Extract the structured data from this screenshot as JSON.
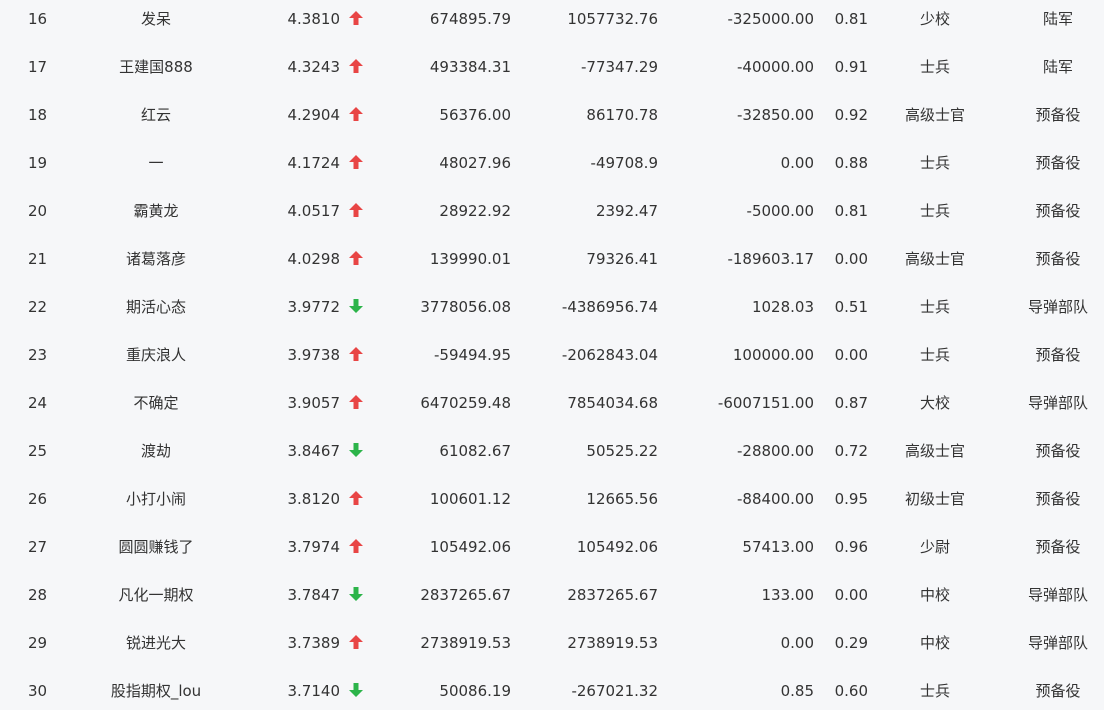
{
  "colors": {
    "up": "#e84545",
    "down": "#2cb44a",
    "text": "#333333",
    "background": "#f6f7f9"
  },
  "rows": [
    {
      "rank": "16",
      "name": "发呆",
      "score": "4.3810",
      "trend": "up",
      "value_a": "674895.79",
      "value_b": "1057732.76",
      "value_c": "-325000.00",
      "ratio": "0.81",
      "military_rank": "少校",
      "unit": "陆军"
    },
    {
      "rank": "17",
      "name": "王建国888",
      "score": "4.3243",
      "trend": "up",
      "value_a": "493384.31",
      "value_b": "-77347.29",
      "value_c": "-40000.00",
      "ratio": "0.91",
      "military_rank": "士兵",
      "unit": "陆军"
    },
    {
      "rank": "18",
      "name": "红云",
      "score": "4.2904",
      "trend": "up",
      "value_a": "56376.00",
      "value_b": "86170.78",
      "value_c": "-32850.00",
      "ratio": "0.92",
      "military_rank": "高级士官",
      "unit": "预备役"
    },
    {
      "rank": "19",
      "name": "一",
      "score": "4.1724",
      "trend": "up",
      "value_a": "48027.96",
      "value_b": "-49708.9",
      "value_c": "0.00",
      "ratio": "0.88",
      "military_rank": "士兵",
      "unit": "预备役"
    },
    {
      "rank": "20",
      "name": "霸黄龙",
      "score": "4.0517",
      "trend": "up",
      "value_a": "28922.92",
      "value_b": "2392.47",
      "value_c": "-5000.00",
      "ratio": "0.81",
      "military_rank": "士兵",
      "unit": "预备役"
    },
    {
      "rank": "21",
      "name": "诸葛落彦",
      "score": "4.0298",
      "trend": "up",
      "value_a": "139990.01",
      "value_b": "79326.41",
      "value_c": "-189603.17",
      "ratio": "0.00",
      "military_rank": "高级士官",
      "unit": "预备役"
    },
    {
      "rank": "22",
      "name": "期活心态",
      "score": "3.9772",
      "trend": "down",
      "value_a": "3778056.08",
      "value_b": "-4386956.74",
      "value_c": "1028.03",
      "ratio": "0.51",
      "military_rank": "士兵",
      "unit": "导弹部队"
    },
    {
      "rank": "23",
      "name": "重庆浪人",
      "score": "3.9738",
      "trend": "up",
      "value_a": "-59494.95",
      "value_b": "-2062843.04",
      "value_c": "100000.00",
      "ratio": "0.00",
      "military_rank": "士兵",
      "unit": "预备役"
    },
    {
      "rank": "24",
      "name": "不确定",
      "score": "3.9057",
      "trend": "up",
      "value_a": "6470259.48",
      "value_b": "7854034.68",
      "value_c": "-6007151.00",
      "ratio": "0.87",
      "military_rank": "大校",
      "unit": "导弹部队"
    },
    {
      "rank": "25",
      "name": "渡劫",
      "score": "3.8467",
      "trend": "down",
      "value_a": "61082.67",
      "value_b": "50525.22",
      "value_c": "-28800.00",
      "ratio": "0.72",
      "military_rank": "高级士官",
      "unit": "预备役"
    },
    {
      "rank": "26",
      "name": "小打小闹",
      "score": "3.8120",
      "trend": "up",
      "value_a": "100601.12",
      "value_b": "12665.56",
      "value_c": "-88400.00",
      "ratio": "0.95",
      "military_rank": "初级士官",
      "unit": "预备役"
    },
    {
      "rank": "27",
      "name": "圆圆赚钱了",
      "score": "3.7974",
      "trend": "up",
      "value_a": "105492.06",
      "value_b": "105492.06",
      "value_c": "57413.00",
      "ratio": "0.96",
      "military_rank": "少尉",
      "unit": "预备役"
    },
    {
      "rank": "28",
      "name": "凡化一期权",
      "score": "3.7847",
      "trend": "down",
      "value_a": "2837265.67",
      "value_b": "2837265.67",
      "value_c": "133.00",
      "ratio": "0.00",
      "military_rank": "中校",
      "unit": "导弹部队"
    },
    {
      "rank": "29",
      "name": "锐进光大",
      "score": "3.7389",
      "trend": "up",
      "value_a": "2738919.53",
      "value_b": "2738919.53",
      "value_c": "0.00",
      "ratio": "0.29",
      "military_rank": "中校",
      "unit": "导弹部队"
    },
    {
      "rank": "30",
      "name": "股指期权_lou",
      "score": "3.7140",
      "trend": "down",
      "value_a": "50086.19",
      "value_b": "-267021.32",
      "value_c": "0.85",
      "ratio": "0.60",
      "military_rank": "士兵",
      "unit": "预备役"
    }
  ]
}
